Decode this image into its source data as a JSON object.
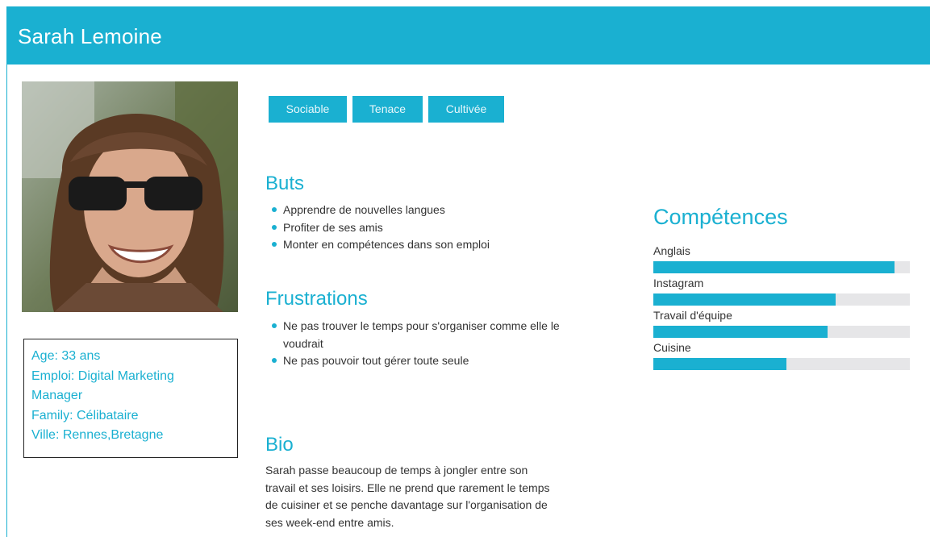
{
  "header": {
    "title": "Sarah Lemoine"
  },
  "profile": {
    "info": [
      "Age: 33 ans",
      "Emploi: Digital Marketing",
      "Manager",
      "Family: Célibataire",
      "Ville: Rennes,Bretagne"
    ]
  },
  "traits": [
    "Sociable",
    "Tenace",
    "Cultivée"
  ],
  "goals": {
    "title": "Buts",
    "items": [
      "Apprendre de nouvelles langues",
      "Profiter de ses amis",
      "Monter en compétences dans son emploi"
    ]
  },
  "frustrations": {
    "title": "Frustrations",
    "items": [
      "Ne pas trouver le temps pour s'organiser comme elle le voudrait",
      "Ne pas pouvoir tout gérer toute seule"
    ]
  },
  "bio": {
    "title": "Bio",
    "text": "Sarah passe beaucoup de temps à jongler entre son travail et ses loisirs. Elle ne prend que rarement le temps de cuisiner et se penche davantage sur l'organisation de ses week-end entre amis."
  },
  "skills": {
    "title": "Compétences",
    "items": [
      {
        "label": "Anglais",
        "level": 0.94
      },
      {
        "label": "Instagram",
        "level": 0.71
      },
      {
        "label": "Travail d'équipe",
        "level": 0.68
      },
      {
        "label": "Cuisine",
        "level": 0.52
      }
    ]
  },
  "colors": {
    "accent": "#1ab0d1",
    "track": "#e6e6e8",
    "text": "#333333"
  }
}
